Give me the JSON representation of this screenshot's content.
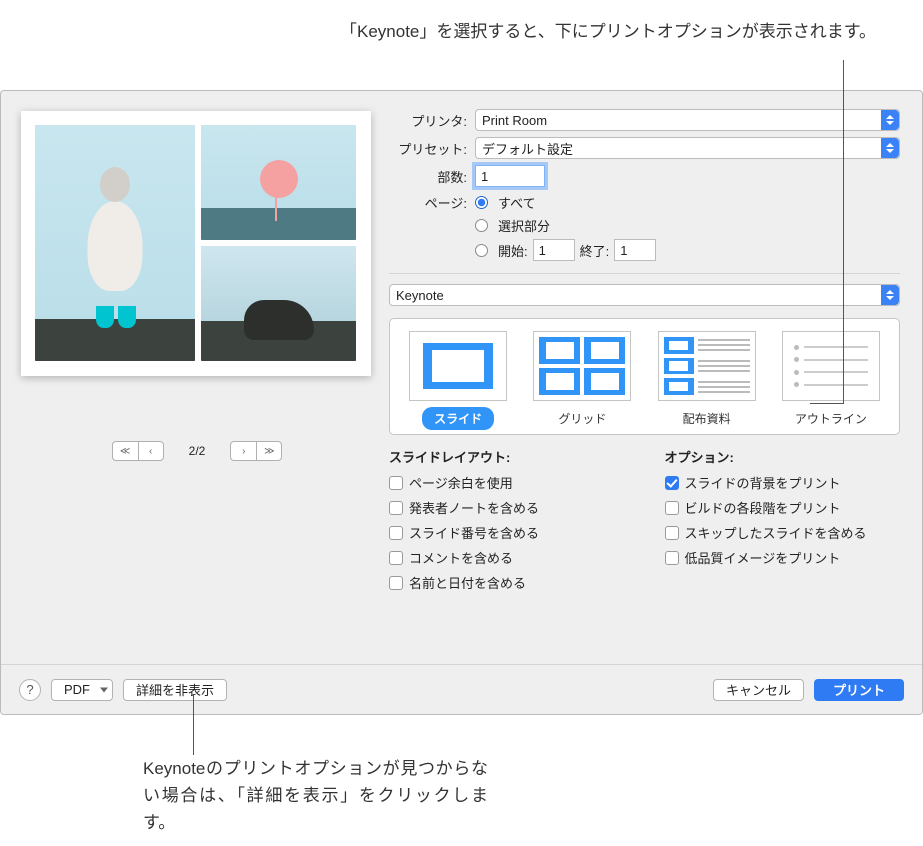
{
  "annotations": {
    "top": "「Keynote」を選択すると、下にプリントオプションが表示されます。",
    "bottom": "Keynoteのプリントオプションが見つからない場合は、「詳細を表示」をクリックします。"
  },
  "labels": {
    "printer": "プリンタ:",
    "preset": "プリセット:",
    "copies": "部数:",
    "pages": "ページ:",
    "all": "すべて",
    "selection": "選択部分",
    "from": "開始:",
    "to": "終了:"
  },
  "values": {
    "printer": "Print Room",
    "preset": "デフォルト設定",
    "copies": "1",
    "page_from": "1",
    "page_to": "1",
    "page_counter": "2/2",
    "app_section": "Keynote"
  },
  "layout": {
    "slide": "スライド",
    "grid": "グリッド",
    "handout": "配布資料",
    "outline": "アウトライン"
  },
  "slide_layout": {
    "heading": "スライドレイアウト:",
    "use_margins": "ページ余白を使用",
    "presenter_notes": "発表者ノートを含める",
    "slide_numbers": "スライド番号を含める",
    "comments": "コメントを含める",
    "name_date": "名前と日付を含める"
  },
  "options": {
    "heading": "オプション:",
    "print_bg": "スライドの背景をプリント",
    "print_builds": "ビルドの各段階をプリント",
    "skipped": "スキップしたスライドを含める",
    "low_quality": "低品質イメージをプリント"
  },
  "footer": {
    "help": "?",
    "pdf": "PDF",
    "hide_details": "詳細を非表示",
    "cancel": "キャンセル",
    "print": "プリント"
  }
}
